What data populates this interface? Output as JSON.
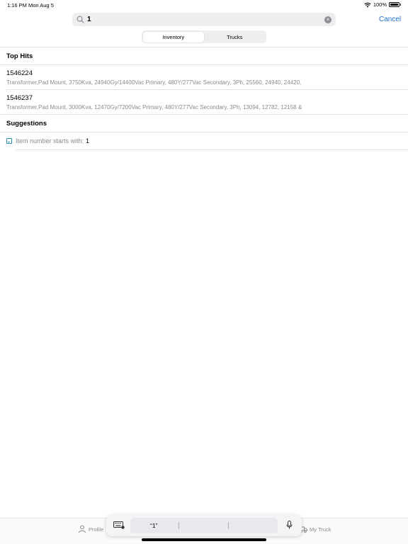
{
  "status_bar": {
    "time": "1:16 PM",
    "date": "Mon Aug 5",
    "battery": "100%"
  },
  "search": {
    "value": "1",
    "cancel_label": "Cancel"
  },
  "segments": [
    {
      "label": "Inventory",
      "active": true
    },
    {
      "label": "Trucks",
      "active": false
    }
  ],
  "top_hits": {
    "title": "Top Hits",
    "items": [
      {
        "number": "1546224",
        "description": "Transformer,Pad Mount, 3750Kva, 24940Gy/14400Vac Primary, 480Y/277Vac Secondary, 3Ph, 25560, 24940, 24420,"
      },
      {
        "number": "1546237",
        "description": "Transformer,Pad Mount, 3000Kva, 12470Gy/7200Vac Primary, 480Y/277Vac Secondary, 3Ph, 13094, 12782, 12158 &"
      }
    ]
  },
  "suggestions": {
    "title": "Suggestions",
    "items": [
      {
        "label": "Item number starts with:",
        "value": "1"
      }
    ]
  },
  "tab_bar": {
    "profile_label": "Profile",
    "my_truck_label": "My Truck"
  },
  "keyboard_toolbar": {
    "prediction": "“1”"
  },
  "colors": {
    "accent": "#1b6fd1",
    "secondary_text": "#8a8a8e"
  }
}
